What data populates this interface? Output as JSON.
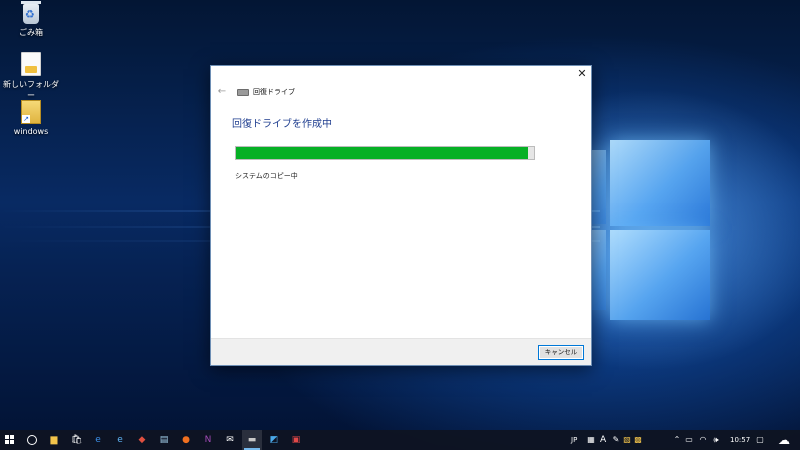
{
  "desktop": {
    "icons": [
      {
        "label": "ごみ箱",
        "icon": "recycle-bin-icon"
      },
      {
        "label": "新しいフォルダー",
        "icon": "folder-document-icon"
      },
      {
        "label": "windows",
        "icon": "shortcut-file-icon"
      }
    ]
  },
  "dialog": {
    "title": "回復ドライブ",
    "heading": "回復ドライブを作成中",
    "status": "システムのコピー中",
    "progress_percent": 98,
    "cancel_label": "キャンセル",
    "close_glyph": "✕",
    "back_glyph": "←",
    "accent_color": "#06b025"
  },
  "taskbar": {
    "apps": [
      {
        "name": "file-explorer-icon",
        "glyph": "▆",
        "color": "#f3c44b",
        "active": false
      },
      {
        "name": "store-icon",
        "glyph": "🛍",
        "color": "#ffffff",
        "active": false
      },
      {
        "name": "edge-icon",
        "glyph": "e",
        "color": "#3b8ee6",
        "active": false
      },
      {
        "name": "internet-explorer-icon",
        "glyph": "e",
        "color": "#5fb4f5",
        "active": false
      },
      {
        "name": "paint-icon",
        "glyph": "◆",
        "color": "#e05040",
        "active": false
      },
      {
        "name": "notepad-icon",
        "glyph": "▤",
        "color": "#a8d4f0",
        "active": false
      },
      {
        "name": "firefox-icon",
        "glyph": "●",
        "color": "#f07020",
        "active": false
      },
      {
        "name": "onenote-icon",
        "glyph": "N",
        "color": "#a04ab5",
        "active": false
      },
      {
        "name": "mail-icon",
        "glyph": "✉",
        "color": "#ffffff",
        "active": false
      },
      {
        "name": "recovery-drive-icon",
        "glyph": "▬",
        "color": "#c8c8c8",
        "active": true
      },
      {
        "name": "control-panel-icon",
        "glyph": "◩",
        "color": "#4aa8e8",
        "active": false
      },
      {
        "name": "app-red-icon",
        "glyph": "▣",
        "color": "#e04848",
        "active": false
      }
    ],
    "tray": {
      "ime": "JP",
      "ime_mode": "A",
      "time": "10:57"
    }
  }
}
